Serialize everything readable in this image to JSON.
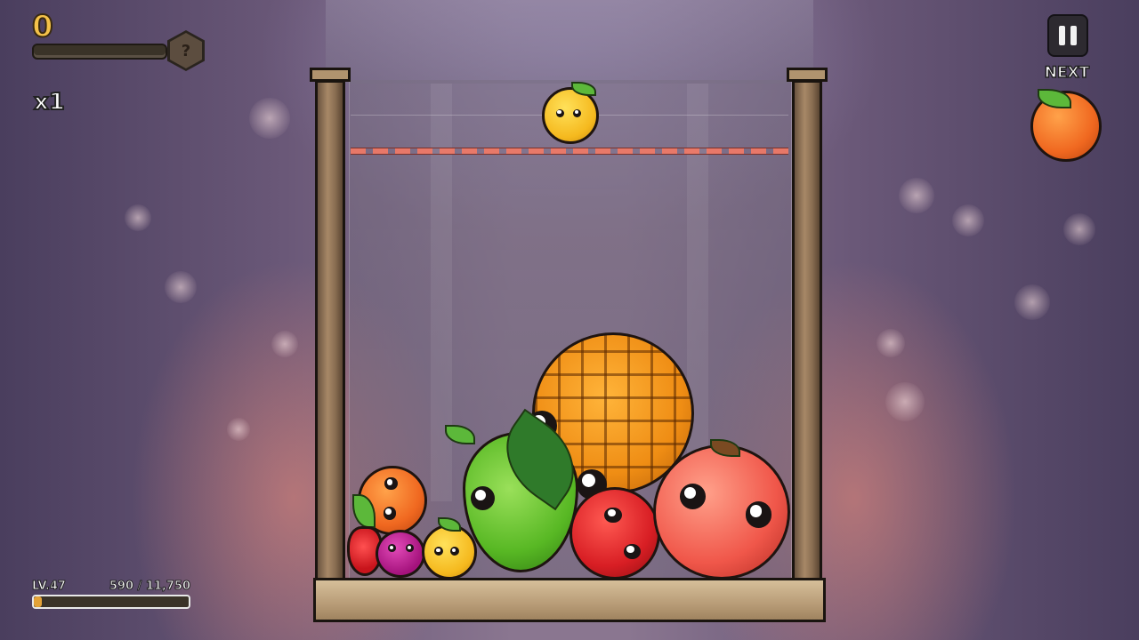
{
  "hud": {
    "score": "0",
    "multiplier": "x1",
    "mystery_label": "?",
    "next_label": "NEXT",
    "level_label": "LV.47",
    "level_progress_text": "590 / 11,750",
    "level_progress_fraction": 0.05
  },
  "game": {
    "current_fruit": "lemon",
    "next_fruit": "orange",
    "fruits_in_container": [
      "strawberry",
      "orange",
      "plum",
      "lemon",
      "pear",
      "pineapple",
      "apple",
      "peach"
    ]
  },
  "colors": {
    "score": "#f5c24a",
    "dropline": "#f47a66",
    "level_fill": "#e3a238"
  }
}
